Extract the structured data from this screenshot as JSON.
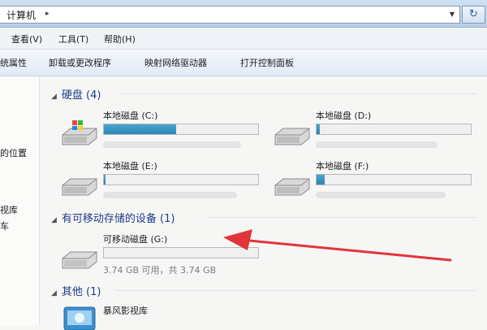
{
  "address": {
    "path": "计算机",
    "chevron": "▸",
    "dropdown": "▼",
    "refresh": "↻"
  },
  "menu": [
    {
      "label": "查看(V)"
    },
    {
      "label": "工具(T)"
    },
    {
      "label": "帮助(H)"
    }
  ],
  "toolbar": [
    {
      "label": "统属性"
    },
    {
      "label": "卸载或更改程序"
    },
    {
      "label": "映射网络驱动器"
    },
    {
      "label": "打开控制面板"
    }
  ],
  "nav": [
    {
      "label": "的位置"
    },
    {
      "label": "视库"
    },
    {
      "label": "车"
    }
  ],
  "groups": {
    "hdd": {
      "title": "硬盘 (4)",
      "arrow": "◢"
    },
    "removable": {
      "title": "有可移动存储的设备 (1)",
      "arrow": "◢"
    },
    "other": {
      "title": "其他 (1)",
      "arrow": "◢"
    }
  },
  "drives": {
    "c": {
      "label": "本地磁盘 (C:)",
      "used_fraction": 0.47
    },
    "d": {
      "label": "本地磁盘 (D:)",
      "used_fraction": 0.02
    },
    "e": {
      "label": "本地磁盘 (E:)",
      "used_fraction": 0.01
    },
    "f": {
      "label": "本地磁盘 (F:)",
      "used_fraction": 0.05
    },
    "g": {
      "label": "可移动磁盘 (G:)",
      "used_fraction": 0.0,
      "sub": "3.74 GB 可用，共 3.74 GB"
    }
  },
  "other": {
    "label": "暴风影视库"
  },
  "colors": {
    "usage_bar": "#2a85b8",
    "group_header": "#1e3b8a",
    "annotation_arrow": "#e0353a"
  }
}
